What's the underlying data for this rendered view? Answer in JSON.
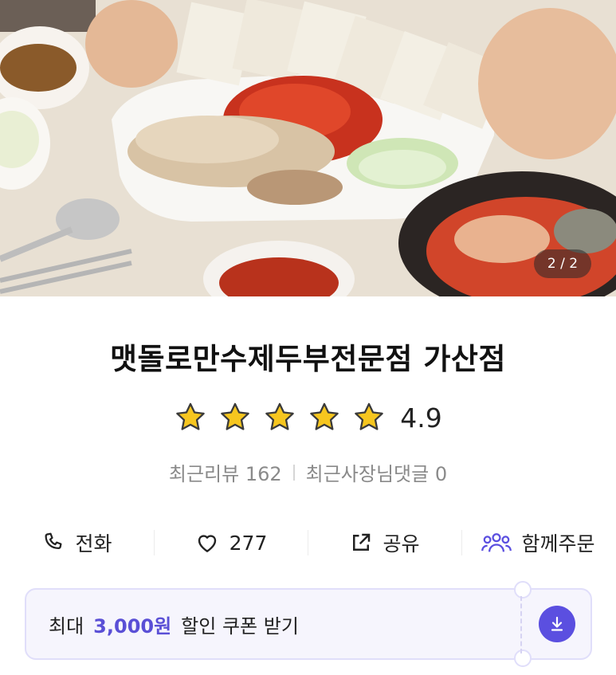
{
  "hero": {
    "image_counter": "2 / 2"
  },
  "store": {
    "name": "맷돌로만수제두부전문점 가산점"
  },
  "rating": {
    "stars": 5,
    "score": "4.9"
  },
  "reviews": {
    "recent_reviews": "최근리뷰 162",
    "owner_replies": "최근사장님댓글 0"
  },
  "actions": [
    {
      "icon": "phone-icon",
      "label": "전화"
    },
    {
      "icon": "heart-icon",
      "label": "277"
    },
    {
      "icon": "share-icon",
      "label": "공유"
    },
    {
      "icon": "group-icon",
      "label": "함께주문"
    }
  ],
  "coupon": {
    "prefix": "최대",
    "amount": "3,000원",
    "suffix": "할인 쿠폰 받기",
    "icon": "download-icon"
  },
  "colors": {
    "accent": "#5b4fe0",
    "star": "#f6c61f",
    "muted_text": "#8a8a8a"
  }
}
